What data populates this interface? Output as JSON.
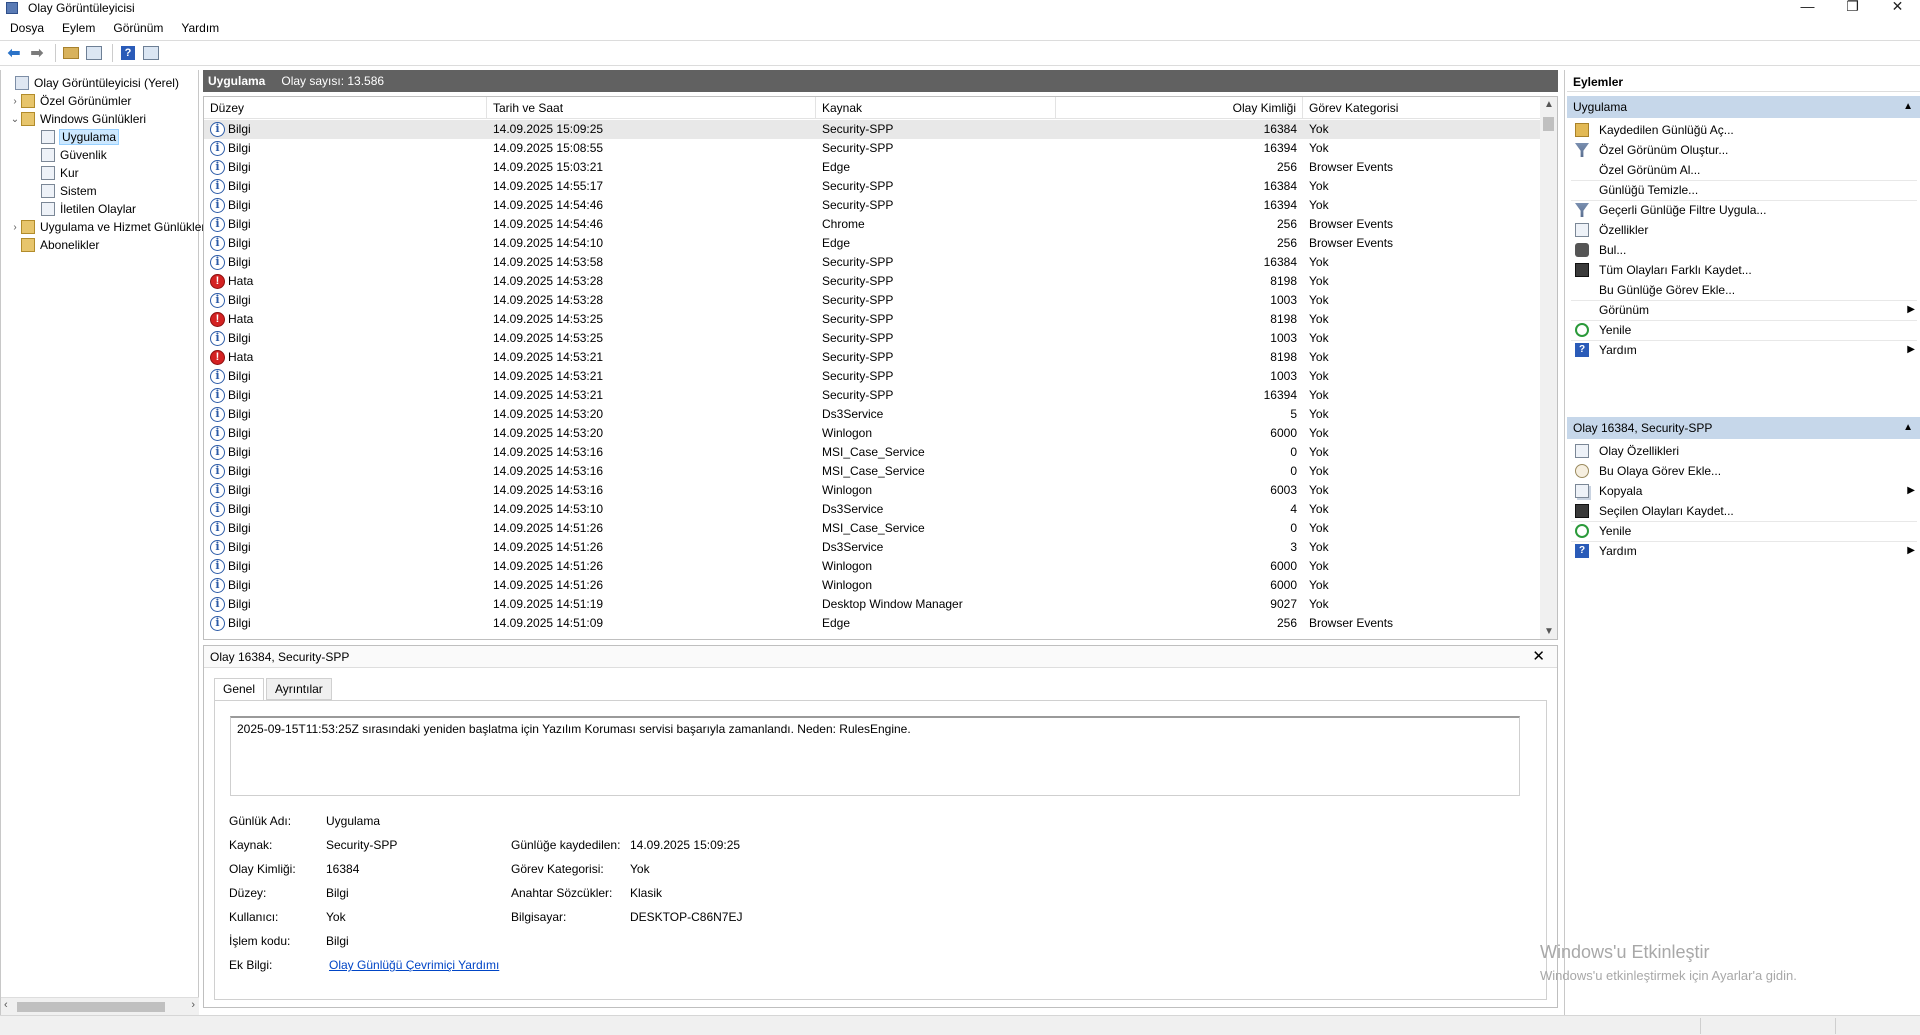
{
  "window": {
    "title": "Olay Görüntüleyicisi",
    "min": "—",
    "max": "❐",
    "close": "✕"
  },
  "menu": [
    "Dosya",
    "Eylem",
    "Görünüm",
    "Yardım"
  ],
  "tree": {
    "items": [
      {
        "label": "Olay Görüntüleyicisi (Yerel)",
        "icon": "computer-icon",
        "exp": ""
      },
      {
        "label": "Özel Görünümler",
        "icon": "folder-icon",
        "exp": "›"
      },
      {
        "label": "Windows Günlükleri",
        "icon": "folder-icon",
        "exp": "⌄"
      },
      {
        "label": "Uygulama",
        "icon": "log-icon",
        "exp": ""
      },
      {
        "label": "Güvenlik",
        "icon": "log-icon",
        "exp": ""
      },
      {
        "label": "Kur",
        "icon": "log-icon",
        "exp": ""
      },
      {
        "label": "Sistem",
        "icon": "log-icon",
        "exp": ""
      },
      {
        "label": "İletilen Olaylar",
        "icon": "log-icon",
        "exp": ""
      },
      {
        "label": "Uygulama ve Hizmet Günlükleri",
        "icon": "folder-icon",
        "exp": "›"
      },
      {
        "label": "Abonelikler",
        "icon": "folder-icon",
        "exp": ""
      }
    ]
  },
  "middle": {
    "title": "Uygulama",
    "count": "Olay sayısı: 13.586"
  },
  "table": {
    "headers": [
      "Düzey",
      "Tarih ve Saat",
      "Kaynak",
      "Olay Kimliği",
      "Görev Kategorisi"
    ],
    "rows": [
      {
        "level": "Bilgi",
        "date": "14.09.2025 15:09:25",
        "source": "Security-SPP",
        "id": "16384",
        "cat": "Yok"
      },
      {
        "level": "Bilgi",
        "date": "14.09.2025 15:08:55",
        "source": "Security-SPP",
        "id": "16394",
        "cat": "Yok"
      },
      {
        "level": "Bilgi",
        "date": "14.09.2025 15:03:21",
        "source": "Edge",
        "id": "256",
        "cat": "Browser Events"
      },
      {
        "level": "Bilgi",
        "date": "14.09.2025 14:55:17",
        "source": "Security-SPP",
        "id": "16384",
        "cat": "Yok"
      },
      {
        "level": "Bilgi",
        "date": "14.09.2025 14:54:46",
        "source": "Security-SPP",
        "id": "16394",
        "cat": "Yok"
      },
      {
        "level": "Bilgi",
        "date": "14.09.2025 14:54:46",
        "source": "Chrome",
        "id": "256",
        "cat": "Browser Events"
      },
      {
        "level": "Bilgi",
        "date": "14.09.2025 14:54:10",
        "source": "Edge",
        "id": "256",
        "cat": "Browser Events"
      },
      {
        "level": "Bilgi",
        "date": "14.09.2025 14:53:58",
        "source": "Security-SPP",
        "id": "16384",
        "cat": "Yok"
      },
      {
        "level": "Hata",
        "date": "14.09.2025 14:53:28",
        "source": "Security-SPP",
        "id": "8198",
        "cat": "Yok"
      },
      {
        "level": "Bilgi",
        "date": "14.09.2025 14:53:28",
        "source": "Security-SPP",
        "id": "1003",
        "cat": "Yok"
      },
      {
        "level": "Hata",
        "date": "14.09.2025 14:53:25",
        "source": "Security-SPP",
        "id": "8198",
        "cat": "Yok"
      },
      {
        "level": "Bilgi",
        "date": "14.09.2025 14:53:25",
        "source": "Security-SPP",
        "id": "1003",
        "cat": "Yok"
      },
      {
        "level": "Hata",
        "date": "14.09.2025 14:53:21",
        "source": "Security-SPP",
        "id": "8198",
        "cat": "Yok"
      },
      {
        "level": "Bilgi",
        "date": "14.09.2025 14:53:21",
        "source": "Security-SPP",
        "id": "1003",
        "cat": "Yok"
      },
      {
        "level": "Bilgi",
        "date": "14.09.2025 14:53:21",
        "source": "Security-SPP",
        "id": "16394",
        "cat": "Yok"
      },
      {
        "level": "Bilgi",
        "date": "14.09.2025 14:53:20",
        "source": "Ds3Service",
        "id": "5",
        "cat": "Yok"
      },
      {
        "level": "Bilgi",
        "date": "14.09.2025 14:53:20",
        "source": "Winlogon",
        "id": "6000",
        "cat": "Yok"
      },
      {
        "level": "Bilgi",
        "date": "14.09.2025 14:53:16",
        "source": "MSI_Case_Service",
        "id": "0",
        "cat": "Yok"
      },
      {
        "level": "Bilgi",
        "date": "14.09.2025 14:53:16",
        "source": "MSI_Case_Service",
        "id": "0",
        "cat": "Yok"
      },
      {
        "level": "Bilgi",
        "date": "14.09.2025 14:53:16",
        "source": "Winlogon",
        "id": "6003",
        "cat": "Yok"
      },
      {
        "level": "Bilgi",
        "date": "14.09.2025 14:53:10",
        "source": "Ds3Service",
        "id": "4",
        "cat": "Yok"
      },
      {
        "level": "Bilgi",
        "date": "14.09.2025 14:51:26",
        "source": "MSI_Case_Service",
        "id": "0",
        "cat": "Yok"
      },
      {
        "level": "Bilgi",
        "date": "14.09.2025 14:51:26",
        "source": "Ds3Service",
        "id": "3",
        "cat": "Yok"
      },
      {
        "level": "Bilgi",
        "date": "14.09.2025 14:51:26",
        "source": "Winlogon",
        "id": "6000",
        "cat": "Yok"
      },
      {
        "level": "Bilgi",
        "date": "14.09.2025 14:51:26",
        "source": "Winlogon",
        "id": "6000",
        "cat": "Yok"
      },
      {
        "level": "Bilgi",
        "date": "14.09.2025 14:51:19",
        "source": "Desktop Window Manager",
        "id": "9027",
        "cat": "Yok"
      },
      {
        "level": "Bilgi",
        "date": "14.09.2025 14:51:09",
        "source": "Edge",
        "id": "256",
        "cat": "Browser Events"
      }
    ]
  },
  "detail": {
    "title": "Olay 16384, Security-SPP",
    "close": "✕",
    "tabs": [
      "Genel",
      "Ayrıntılar"
    ],
    "message": "2025-09-15T11:53:25Z sırasındaki yeniden başlatma için Yazılım Koruması servisi başarıyla zamanlandı. Neden: RulesEngine.",
    "fields": {
      "log_name_label": "Günlük Adı:",
      "log_name": "Uygulama",
      "source_label": "Kaynak:",
      "source": "Security-SPP",
      "logged_label": "Günlüğe kaydedilen:",
      "logged": "14.09.2025 15:09:25",
      "event_id_label": "Olay Kimliği:",
      "event_id": "16384",
      "task_cat_label": "Görev Kategorisi:",
      "task_cat": "Yok",
      "level_label": "Düzey:",
      "level": "Bilgi",
      "keywords_label": "Anahtar Sözcükler:",
      "keywords": "Klasik",
      "user_label": "Kullanıcı:",
      "user": "Yok",
      "computer_label": "Bilgisayar:",
      "computer": "DESKTOP-C86N7EJ",
      "opcode_label": "İşlem kodu:",
      "opcode": "Bilgi",
      "more_info_label": "Ek Bilgi:",
      "more_info_link": "Olay Günlüğü Çevrimiçi Yardımı"
    }
  },
  "actions": {
    "header": "Eylemler",
    "section1": "Uygulama",
    "section1_items": [
      {
        "label": "Kaydedilen Günlüğü Aç...",
        "icon": "open-folder-icon",
        "sub": ""
      },
      {
        "label": "Özel Görünüm Oluştur...",
        "icon": "filter-icon",
        "sub": ""
      },
      {
        "label": "Özel Görünüm Al...",
        "icon": "",
        "sub": ""
      },
      {
        "label": "Günlüğü Temizle...",
        "icon": "",
        "sub": ""
      },
      {
        "label": "Geçerli Günlüğe Filtre Uygula...",
        "icon": "filter-icon",
        "sub": ""
      },
      {
        "label": "Özellikler",
        "icon": "properties-icon",
        "sub": ""
      },
      {
        "label": "Bul...",
        "icon": "binoculars-icon",
        "sub": ""
      },
      {
        "label": "Tüm Olayları Farklı Kaydet...",
        "icon": "save-icon",
        "sub": ""
      },
      {
        "label": "Bu Günlüğe Görev Ekle...",
        "icon": "",
        "sub": ""
      },
      {
        "label": "Görünüm",
        "icon": "",
        "sub": "▶"
      },
      {
        "label": "Yenile",
        "icon": "refresh-icon",
        "sub": ""
      },
      {
        "label": "Yardım",
        "icon": "help-icon",
        "sub": "▶"
      }
    ],
    "section2": "Olay 16384, Security-SPP",
    "section2_items": [
      {
        "label": "Olay Özellikleri",
        "icon": "properties-icon",
        "sub": ""
      },
      {
        "label": "Bu Olaya Görev Ekle...",
        "icon": "task-icon",
        "sub": ""
      },
      {
        "label": "Kopyala",
        "icon": "copy-icon",
        "sub": "▶"
      },
      {
        "label": "Seçilen Olayları Kaydet...",
        "icon": "save-icon",
        "sub": ""
      },
      {
        "label": "Yenile",
        "icon": "refresh-icon",
        "sub": ""
      },
      {
        "label": "Yardım",
        "icon": "help-icon",
        "sub": "▶"
      }
    ],
    "caret": "▲"
  },
  "watermark": {
    "line1": "Windows'u Etkinleştir",
    "line2": "Windows'u etkinleştirmek için Ayarlar'a gidin."
  }
}
